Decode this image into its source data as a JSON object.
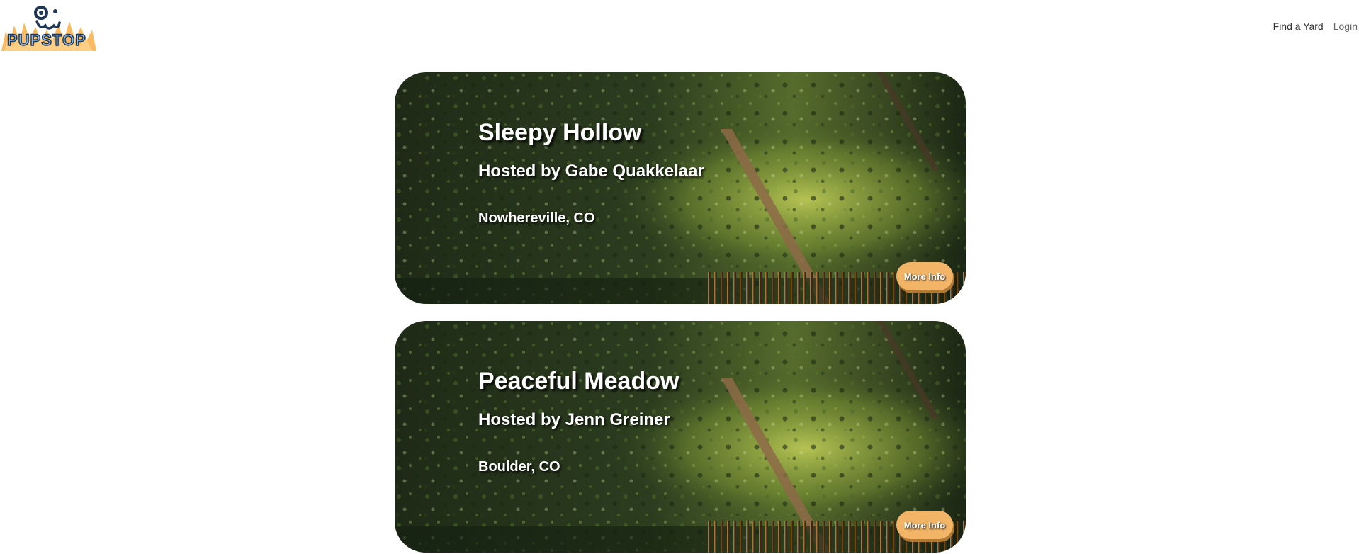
{
  "brand": {
    "logo_text": "PUPSTOP"
  },
  "nav": {
    "find_yard": "Find a Yard",
    "login": "Login"
  },
  "yards": [
    {
      "name": "Sleepy Hollow",
      "host": "Hosted by Gabe Quakkelaar",
      "location": "Nowhereville, CO",
      "button_label": "More Info"
    },
    {
      "name": "Peaceful Meadow",
      "host": "Hosted by Jenn Greiner",
      "location": "Boulder, CO",
      "button_label": "More Info"
    }
  ],
  "colors": {
    "button": "#f2b467",
    "logo_blue": "#8fb6dc",
    "logo_navy": "#1f3757",
    "grass_orange": "#f7a93b"
  }
}
